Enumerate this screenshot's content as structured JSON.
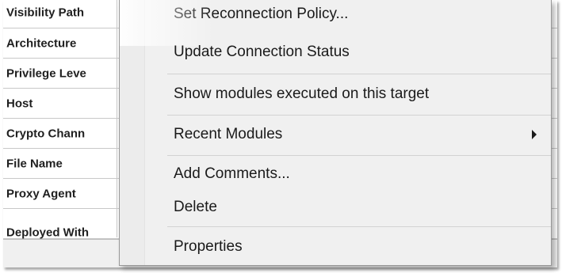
{
  "property_grid": {
    "rows": [
      {
        "label": "Visibility Path"
      },
      {
        "label": "Architecture"
      },
      {
        "label": "Privilege Leve"
      },
      {
        "label": "Host"
      },
      {
        "label": "Crypto Chann"
      },
      {
        "label": "File Name"
      },
      {
        "label": "Proxy Agent"
      },
      {
        "label": "Deployed With"
      }
    ]
  },
  "context_menu": {
    "items": [
      {
        "label": "Set Reconnection Policy..."
      },
      {
        "label": "Update Connection Status"
      },
      {
        "label": "Show modules executed on this target"
      },
      {
        "label": "Recent Modules",
        "submenu_icon": "chevron-right-icon"
      },
      {
        "label": "Add Comments..."
      },
      {
        "label": "Delete"
      },
      {
        "label": "Properties"
      }
    ]
  },
  "colors": {
    "menu_background": "#f0f0f0",
    "menu_border": "#979797",
    "grid_line": "#c8c8c8",
    "text": "#1a1a1a"
  }
}
